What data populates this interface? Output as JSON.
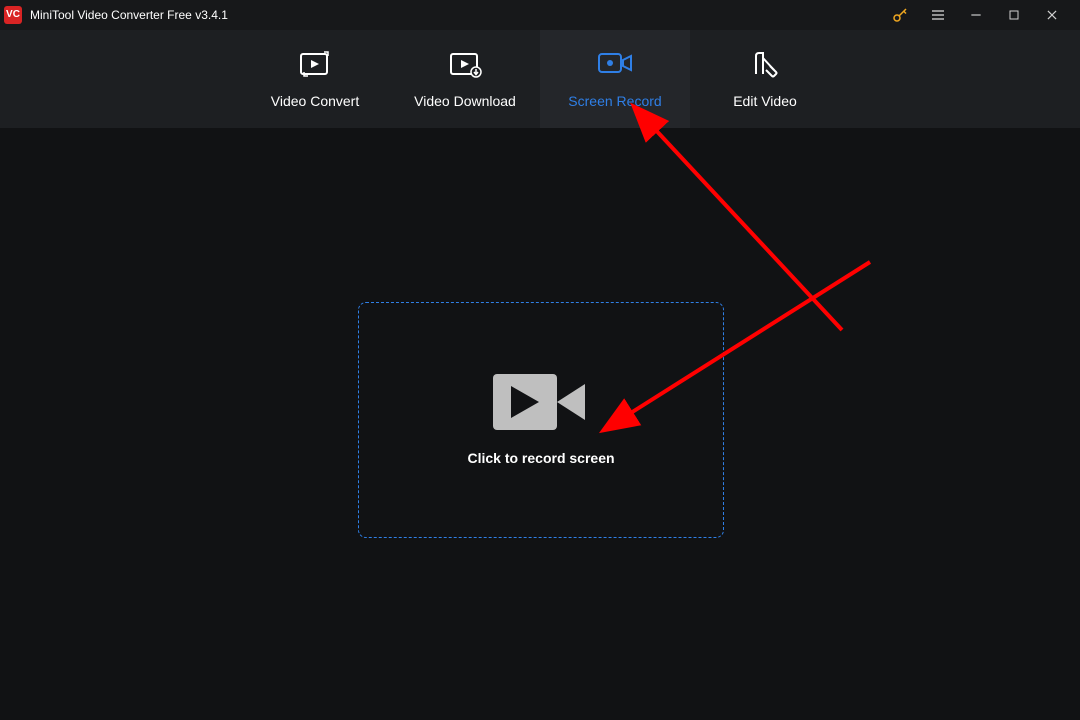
{
  "titlebar": {
    "logo_text": "VC",
    "title": "MiniTool Video Converter Free v3.4.1"
  },
  "nav": {
    "tabs": [
      {
        "id": "video-convert",
        "label": "Video Convert"
      },
      {
        "id": "video-download",
        "label": "Video Download"
      },
      {
        "id": "screen-record",
        "label": "Screen Record"
      },
      {
        "id": "edit-video",
        "label": "Edit Video"
      }
    ],
    "active": "screen-record"
  },
  "main": {
    "record_prompt": "Click to record screen"
  },
  "colors": {
    "accent": "#2f7fe6",
    "brand": "#d92424",
    "key": "#f0a720",
    "arrow": "#ff0000"
  }
}
